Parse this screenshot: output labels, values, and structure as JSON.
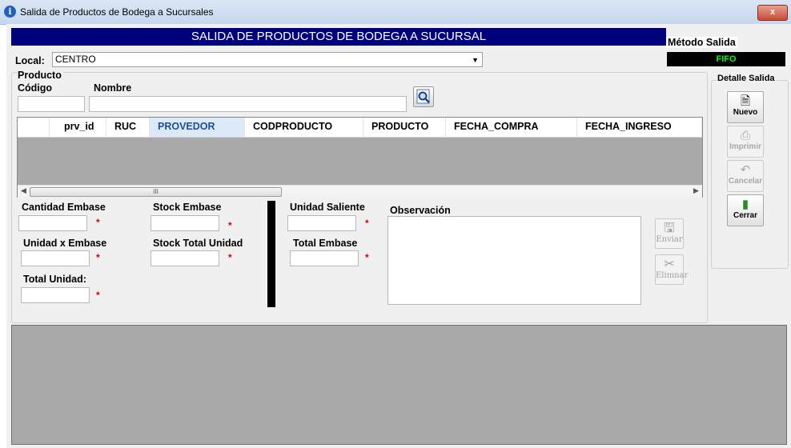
{
  "window": {
    "title": "Salida de Productos de Bodega a Sucursales",
    "close": "x"
  },
  "banner": "SALIDA DE PRODUCTOS DE BODEGA A SUCURSAL",
  "metodo": {
    "label": "Método Salida",
    "value": "FIFO"
  },
  "local": {
    "label": "Local:",
    "value": "CENTRO"
  },
  "producto": {
    "group": "Producto",
    "codigo_label": "Código",
    "nombre_label": "Nombre",
    "codigo_value": "",
    "nombre_value": ""
  },
  "grid": {
    "columns": [
      "prv_id",
      "RUC",
      "PROVEDOR",
      "CODPRODUCTO",
      "PRODUCTO",
      "FECHA_COMPRA",
      "FECHA_INGRESO"
    ],
    "selected_column": "PROVEDOR",
    "rows": [],
    "scroll_thumb": "III"
  },
  "fields": {
    "cantidad_embase": "Cantidad Embase",
    "stock_embase": "Stock Embase",
    "unidad_x_embase": "Unidad x Embase",
    "stock_total_unidad": "Stock Total Unidad",
    "total_unidad": "Total Unidad:",
    "unidad_saliente": "Unidad Saliente",
    "total_embase": "Total Embase",
    "observacion": "Observación",
    "required_mark": "*"
  },
  "actions": {
    "enviar": "Enviar",
    "eliminar": "Elimnar"
  },
  "detalle": {
    "label": "Detalle Salida",
    "nuevo": "Nuevo",
    "imprimir": "Imprimir",
    "cancelar": "Cancelar",
    "cerrar": "Cerrar"
  },
  "colors": {
    "banner": "#00007f",
    "fifo_bg": "#000000",
    "fifo_text": "#00ff00",
    "required": "#e00000",
    "grid_bg": "#a9a9a9"
  }
}
